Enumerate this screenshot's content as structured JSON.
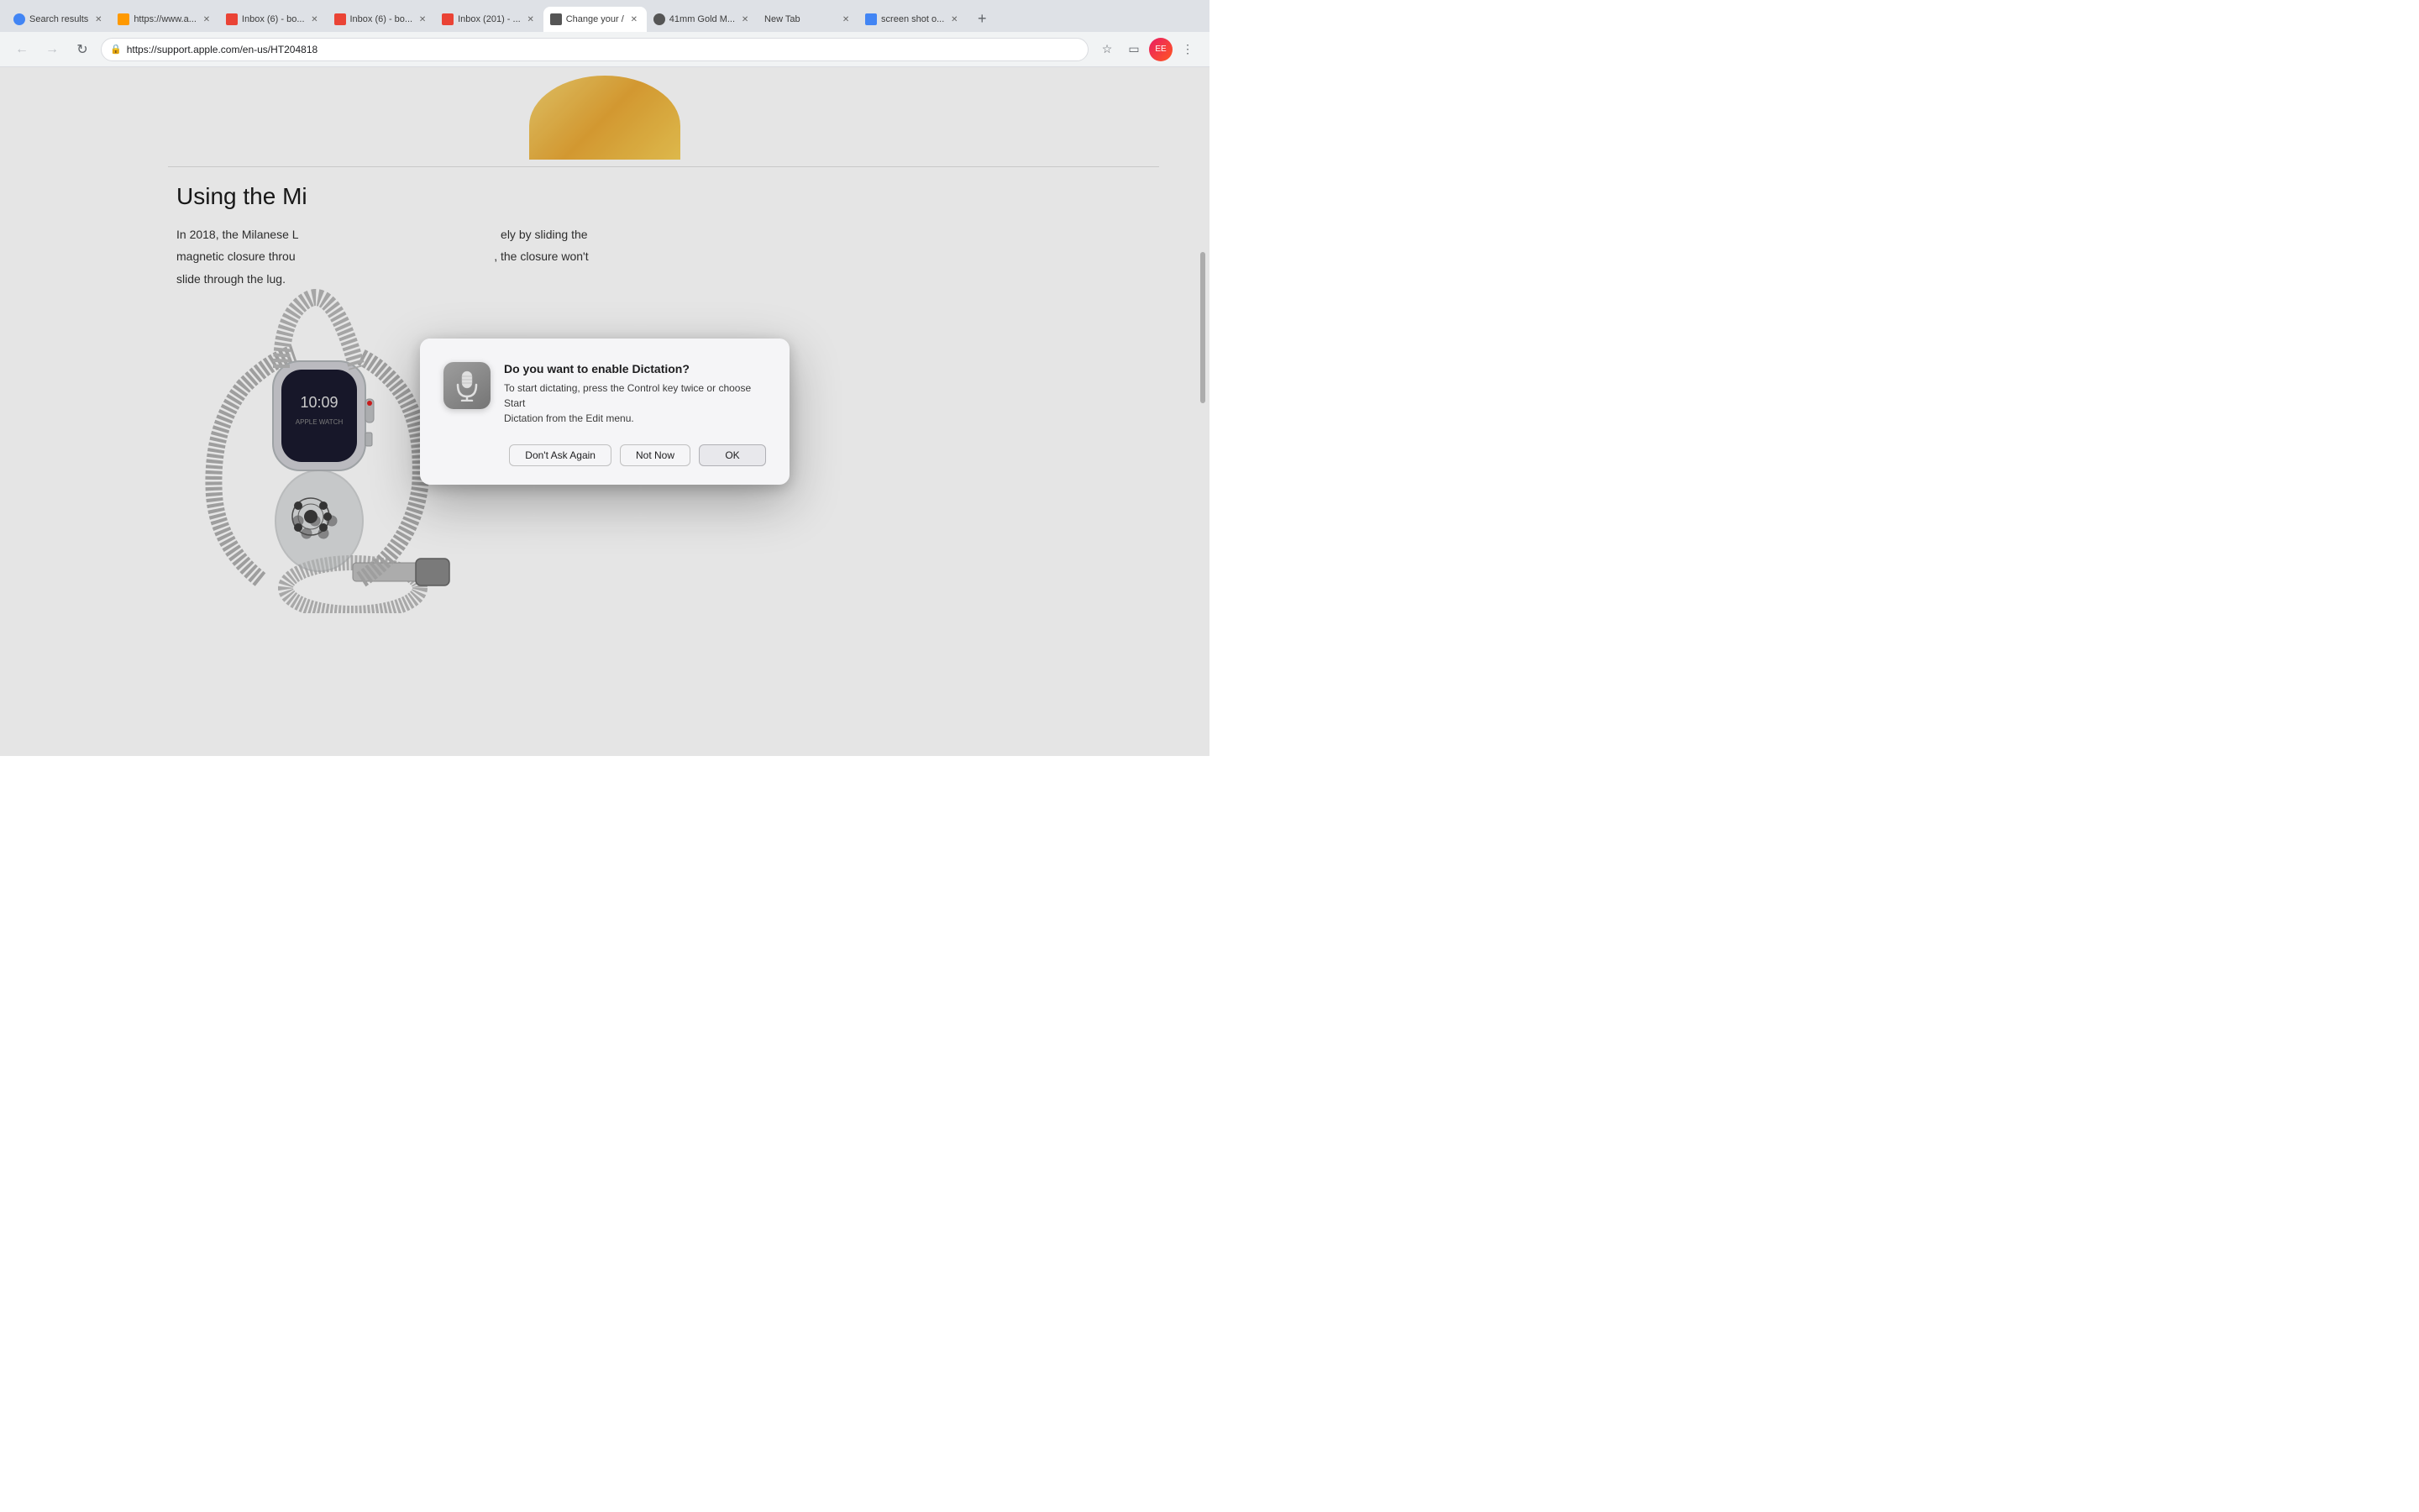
{
  "browser": {
    "tabs": [
      {
        "id": "search-results",
        "label": "Search results",
        "favicon_type": "search",
        "active": false,
        "url": ""
      },
      {
        "id": "amazon",
        "label": "https://www.a...",
        "favicon_type": "amazon",
        "active": false,
        "url": ""
      },
      {
        "id": "inbox-1",
        "label": "Inbox (6) - bo...",
        "favicon_type": "gmail",
        "active": false,
        "url": ""
      },
      {
        "id": "inbox-2",
        "label": "Inbox (6) - bo...",
        "favicon_type": "gmail",
        "active": false,
        "url": ""
      },
      {
        "id": "inbox-3",
        "label": "Inbox (201) - ...",
        "favicon_type": "gmail",
        "active": false,
        "url": ""
      },
      {
        "id": "change-your",
        "label": "Change your /",
        "favicon_type": "apple",
        "active": true,
        "url": ""
      },
      {
        "id": "41mm-gold",
        "label": "41mm Gold M...",
        "favicon_type": "apple",
        "active": false,
        "url": ""
      },
      {
        "id": "new-tab",
        "label": "New Tab",
        "favicon_type": "none",
        "active": false,
        "url": ""
      },
      {
        "id": "screenshot",
        "label": "screen shot o...",
        "favicon_type": "google",
        "active": false,
        "url": ""
      }
    ],
    "address": "https://support.apple.com/en-us/HT204818",
    "new_tab_label": "+"
  },
  "page": {
    "section_heading": "Using the Mi",
    "body_text": "In 2018, the Milanese L",
    "body_text_2": "magnetic closure throu",
    "body_text_3": "slide through the lug.",
    "body_text_full_line1": "In 2018, the Milanese L                                                   ly by sliding the",
    "body_text_full_line2": "magnetic closure throu                                               s, the closure won't",
    "body_text_full_line3": "slide through the lug."
  },
  "dialog": {
    "title": "Do you want to enable Dictation?",
    "message": "To start dictating, press the Control key twice or choose Start\nDictation from the Edit menu.",
    "btn_dont_ask": "Don't Ask Again",
    "btn_not_now": "Not Now",
    "btn_ok": "OK",
    "icon_label": "microphone-icon"
  }
}
